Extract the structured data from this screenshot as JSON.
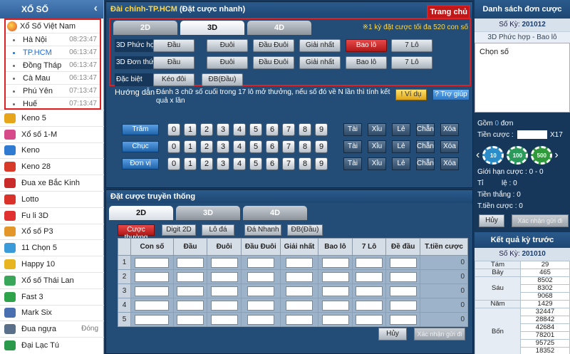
{
  "sidebar": {
    "title": "XỔ SỐ",
    "group_label": "Xổ Số Việt Nam",
    "regional": [
      {
        "name": "Hà Nội",
        "time": "08:23:47"
      },
      {
        "name": "TP.HCM",
        "time": "06:13:47"
      },
      {
        "name": "Đồng Tháp",
        "time": "06:13:47"
      },
      {
        "name": "Cà Mau",
        "time": "06:13:47"
      },
      {
        "name": "Phú Yên",
        "time": "07:13:47"
      },
      {
        "name": "Huế",
        "time": "07:13:47"
      }
    ],
    "games": [
      {
        "name": "Keno 5",
        "icon": "keno5-icon",
        "color": "#e6a51a",
        "badge": ""
      },
      {
        "name": "Xổ số 1-M",
        "icon": "lottery-1m-icon",
        "color": "#d64a8a",
        "badge": ""
      },
      {
        "name": "Keno",
        "icon": "keno-icon",
        "color": "#2f7bd1",
        "badge": ""
      },
      {
        "name": "Keno 28",
        "icon": "keno28-icon",
        "color": "#d83a2a",
        "badge": ""
      },
      {
        "name": "Đua xe Bắc Kinh",
        "icon": "racing-icon",
        "color": "#c92a2a",
        "badge": ""
      },
      {
        "name": "Lotto",
        "icon": "lotto-icon",
        "color": "#d8322a",
        "badge": ""
      },
      {
        "name": "Fu li 3D",
        "icon": "fuli3d-icon",
        "color": "#e03030",
        "badge": ""
      },
      {
        "name": "Xổ số P3",
        "icon": "p3-icon",
        "color": "#e3962a",
        "badge": ""
      },
      {
        "name": "11 Chọn 5",
        "icon": "pick5-icon",
        "color": "#3a9bd8",
        "badge": ""
      },
      {
        "name": "Happy 10",
        "icon": "happy10-icon",
        "color": "#e6b520",
        "badge": ""
      },
      {
        "name": "Xổ số Thái Lan",
        "icon": "thai-icon",
        "color": "#3aa65a",
        "badge": ""
      },
      {
        "name": "Fast 3",
        "icon": "fast3-icon",
        "color": "#2ea34a",
        "badge": ""
      },
      {
        "name": "Mark Six",
        "icon": "marksix-icon",
        "color": "#4a6fb0",
        "badge": ""
      },
      {
        "name": "Đua ngựa",
        "icon": "horse-icon",
        "color": "#5a6f8a",
        "badge": "Đóng"
      },
      {
        "name": "Đại Lạc Tú",
        "icon": "dalactu-icon",
        "color": "#2a9a4a",
        "badge": ""
      }
    ]
  },
  "top_panel": {
    "city": "Đài chính-TP.HCM",
    "mode": "(Đặt cược nhanh)",
    "home": "Trang chủ",
    "tabs": [
      "2D",
      "3D",
      "4D"
    ],
    "limit_note": "※1 kỳ đặt cược tối đa 520 con số",
    "rows": [
      {
        "label": "3D Phức hợp",
        "buttons": [
          "Đầu",
          "Đuôi",
          "Đầu Đuôi",
          "Giải nhất",
          "Bao lô",
          "7 Lô"
        ]
      },
      {
        "label": "3D Đơn thức",
        "buttons": [
          "Đầu",
          "Đuôi",
          "Đầu Đuôi",
          "Giải nhất",
          "Bao lô",
          "7 Lô"
        ]
      },
      {
        "label": "Đặc biệt",
        "buttons": [
          "Kéo đôi",
          "ĐB(Đầu)"
        ]
      }
    ],
    "guide_label": "Hướng dẫn",
    "guide_text": "Đánh 3 chữ số cuối trong 17 lô mở thưởng, nếu số đó về N lần thì tính kết quả x lần",
    "example": "Ví dụ",
    "help": "Trợ giúp",
    "digit_rows": [
      "Trăm",
      "Chục",
      "Đơn vị"
    ],
    "digits": [
      "0",
      "1",
      "2",
      "3",
      "4",
      "5",
      "6",
      "7",
      "8",
      "9"
    ],
    "quick": [
      "Tài",
      "Xỉu",
      "Lẻ",
      "Chẵn",
      "Xóa"
    ]
  },
  "bottom_panel": {
    "title": "Đặt cược truyền thống",
    "tabs": [
      "2D",
      "3D",
      "4D"
    ],
    "buttons": [
      "Cược thường",
      "Digit 2D",
      "Lô đá",
      "Đá Nhanh",
      "ĐB(Đầu)"
    ],
    "columns": [
      "Con số",
      "Đầu",
      "Đuôi",
      "Đầu Đuôi",
      "Giải nhất",
      "Bao lô",
      "7 Lô",
      "Đề đầu",
      "T.tiền cược"
    ],
    "rows": [
      {
        "n": "1",
        "total": "0"
      },
      {
        "n": "2",
        "total": "0"
      },
      {
        "n": "3",
        "total": "0"
      },
      {
        "n": "4",
        "total": "0"
      },
      {
        "n": "5",
        "total": "0"
      }
    ],
    "cancel": "Hủy",
    "confirm": "Xác nhận gửi đi"
  },
  "right_panel": {
    "title": "Danh sách đơn cược",
    "ky_label": "Số Kỳ:",
    "ky_value": "201012",
    "bet_type": "3D Phức hợp - Bao lô",
    "area_text": "Chọn số",
    "gom_prefix": "Gồm",
    "gom_count": "0",
    "gom_suffix": "đơn",
    "tien_cuoc": "Tiền cược :",
    "multiplier": "X17",
    "chips": [
      "10",
      "100",
      "500"
    ],
    "limit": "Giới hạn cược : 0 - 0",
    "ti_le_label": "Tỉ",
    "ti_le_value": "lệ : 0",
    "tien_thang": "Tiền thắng : 0",
    "t_tien_cuoc": "T.tiền cược : 0",
    "cancel": "Hủy",
    "confirm": "Xác nhận gửi đi",
    "results_title": "Kết quả kỳ trước",
    "res_ky_label": "Số Kỳ:",
    "res_ky_value": "201010",
    "results": [
      {
        "prize": "Tám",
        "values": [
          "29"
        ]
      },
      {
        "prize": "Bảy",
        "values": [
          "465"
        ]
      },
      {
        "prize": "Sáu",
        "values": [
          "8502",
          "8302",
          "9068"
        ]
      },
      {
        "prize": "Năm",
        "values": [
          "1429"
        ]
      },
      {
        "prize": "Bốn",
        "values": [
          "32447",
          "28842",
          "42684",
          "78201",
          "95725",
          "18352"
        ]
      }
    ]
  }
}
